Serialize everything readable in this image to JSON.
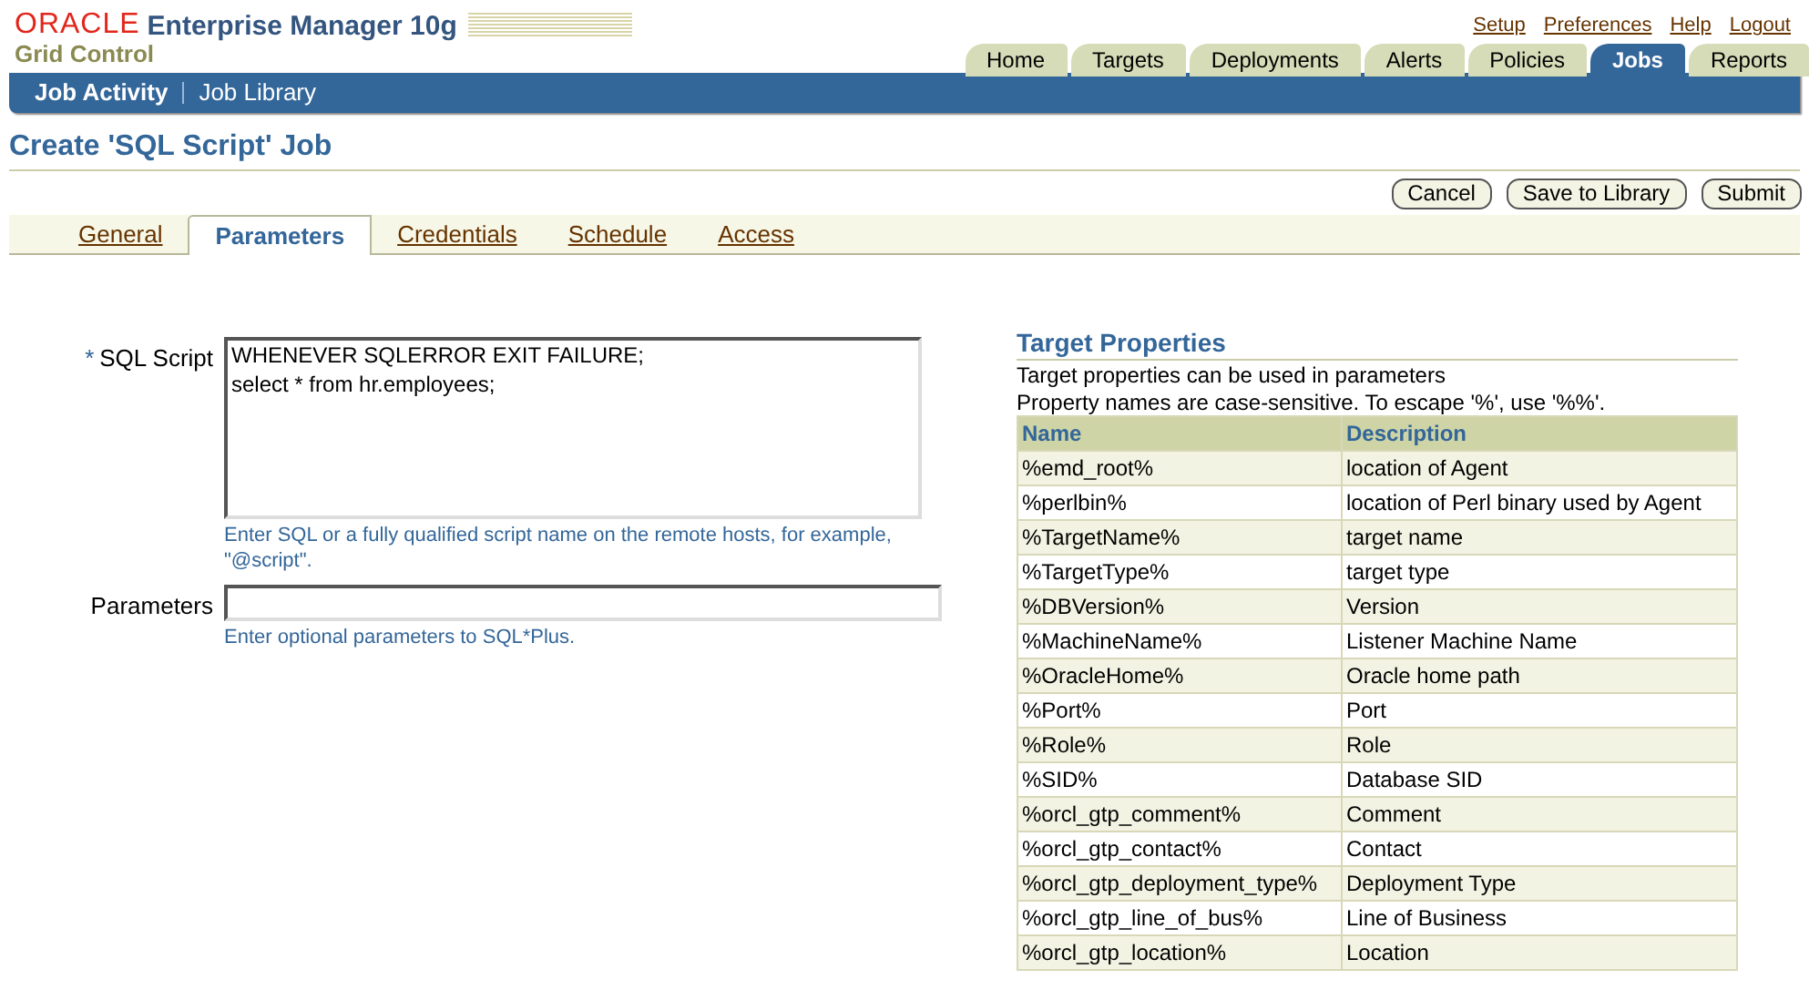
{
  "header": {
    "brand": "ORACLE",
    "product": "Enterprise Manager 10g",
    "subtitle": "Grid Control",
    "global_links": [
      "Setup",
      "Preferences",
      "Help",
      "Logout"
    ]
  },
  "main_tabs": [
    {
      "label": "Home",
      "selected": false
    },
    {
      "label": "Targets",
      "selected": false
    },
    {
      "label": "Deployments",
      "selected": false
    },
    {
      "label": "Alerts",
      "selected": false
    },
    {
      "label": "Policies",
      "selected": false
    },
    {
      "label": "Jobs",
      "selected": true
    },
    {
      "label": "Reports",
      "selected": false
    }
  ],
  "sub_tabs": [
    {
      "label": "Job Activity",
      "selected": true
    },
    {
      "label": "Job Library",
      "selected": false
    }
  ],
  "page_title": "Create 'SQL Script' Job",
  "buttons": [
    "Cancel",
    "Save to Library",
    "Submit"
  ],
  "page_tabs": [
    {
      "label": "General",
      "selected": false
    },
    {
      "label": "Parameters",
      "selected": true
    },
    {
      "label": "Credentials",
      "selected": false
    },
    {
      "label": "Schedule",
      "selected": false
    },
    {
      "label": "Access",
      "selected": false
    }
  ],
  "form": {
    "fields": [
      {
        "kind": "textarea",
        "label": "SQL Script",
        "required_mark": "*",
        "value": "WHENEVER SQLERROR EXIT FAILURE;\nselect * from hr.employees;",
        "hint": "Enter SQL or a fully qualified script name on the remote hosts, for example, \"@script\"."
      },
      {
        "kind": "input",
        "label": "Parameters",
        "hint": "Enter optional parameters to SQL*Plus."
      }
    ]
  },
  "target_properties": {
    "title": "Target Properties",
    "notes": [
      "Target properties can be used in parameters",
      "Property names are case-sensitive. To escape '%', use '%%'."
    ],
    "columns": [
      "Name",
      "Description"
    ],
    "rows": [
      [
        "%emd_root%",
        "location of Agent"
      ],
      [
        "%perlbin%",
        "location of Perl binary used by Agent"
      ],
      [
        "%TargetName%",
        "target name"
      ],
      [
        "%TargetType%",
        "target type"
      ],
      [
        "%DBVersion%",
        "Version"
      ],
      [
        "%MachineName%",
        "Listener Machine Name"
      ],
      [
        "%OracleHome%",
        "Oracle home path"
      ],
      [
        "%Port%",
        "Port"
      ],
      [
        "%Role%",
        "Role"
      ],
      [
        "%SID%",
        "Database SID"
      ],
      [
        "%orcl_gtp_comment%",
        "Comment"
      ],
      [
        "%orcl_gtp_contact%",
        "Contact"
      ],
      [
        "%orcl_gtp_deployment_type%",
        "Deployment Type"
      ],
      [
        "%orcl_gtp_line_of_bus%",
        "Line of Business"
      ],
      [
        "%orcl_gtp_location%",
        "Location"
      ]
    ]
  }
}
